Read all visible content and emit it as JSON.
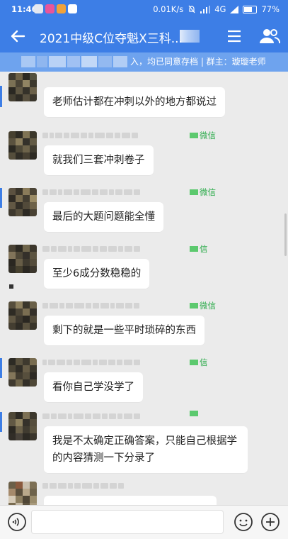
{
  "status_bar": {
    "time": "11:46",
    "network_speed": "0.01K/s",
    "network_type": "4G",
    "battery": "77%",
    "battery_level": 0.77
  },
  "app_bar": {
    "title": "2021中级C位夺魁X三科...",
    "back_icon": "arrow-left-icon",
    "menu_icon": "hamburger-icon",
    "members_icon": "group-members-icon"
  },
  "notice": {
    "text": "入，均已同意存档 | 群主：璇璇老师"
  },
  "messages": [
    {
      "text": "老师估计都在冲刺以外的地方都说过",
      "source": ""
    },
    {
      "text": "就我们三套冲刺卷子",
      "source": "微信"
    },
    {
      "text": "最后的大题问题能全懂",
      "source": "微信"
    },
    {
      "text": "至少6成分数稳稳的",
      "source": "信"
    },
    {
      "text": "剩下的就是一些平时琐碎的东西",
      "source": "微信"
    },
    {
      "text": "看你自己学没学了",
      "source": "信"
    },
    {
      "text": "我是不太确定正确答案，只能自己根据学的内容猜测一下分录了",
      "source": ""
    }
  ],
  "input_bar": {
    "placeholder": "",
    "voice_icon": "voice-icon",
    "emoji_icon": "emoji-icon",
    "plus_icon": "plus-icon"
  },
  "colors": {
    "primary": "#3d7ee6",
    "notice_bg": "#6ea3ee",
    "wechat_green": "#2bab4a",
    "chat_bg": "#ebebeb"
  }
}
